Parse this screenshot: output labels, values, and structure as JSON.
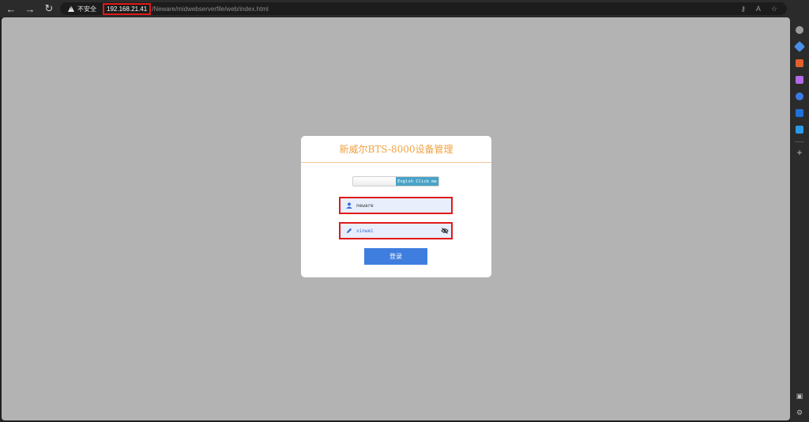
{
  "browser": {
    "security_text": "不安全",
    "host": "192.168.21.41",
    "path": "/Neware/midwebserverfile/web/index.html"
  },
  "login": {
    "title": "新威尔BTS-8000设备管理",
    "lang_button": "Englsh Click me",
    "username_value": "neware",
    "password_value": "xinwei",
    "submit_label": "登录"
  },
  "colors": {
    "accent": "#f0a040",
    "button": "#3f7ede",
    "highlight_border": "#e01a1a"
  }
}
